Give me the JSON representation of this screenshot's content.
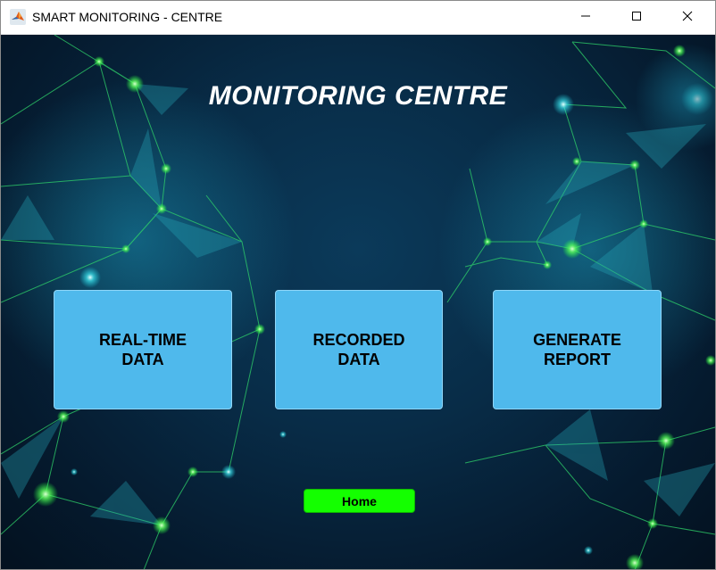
{
  "window": {
    "title": "SMART MONITORING - CENTRE",
    "app_icon": "matlab-icon",
    "controls": [
      "minimize-icon",
      "maximize-icon",
      "close-icon"
    ]
  },
  "main": {
    "title": "MONITORING CENTRE",
    "buttons": {
      "realtime": "REAL-TIME\nDATA",
      "recorded": "RECORDED\nDATA",
      "report": "GENERATE\nREPORT"
    },
    "home_label": "Home"
  },
  "colors": {
    "background": "#082c47",
    "button": "#4fb9ec",
    "home_button": "#14ff00",
    "network_lines": "#2fd36a",
    "title_text": "#ffffff"
  }
}
